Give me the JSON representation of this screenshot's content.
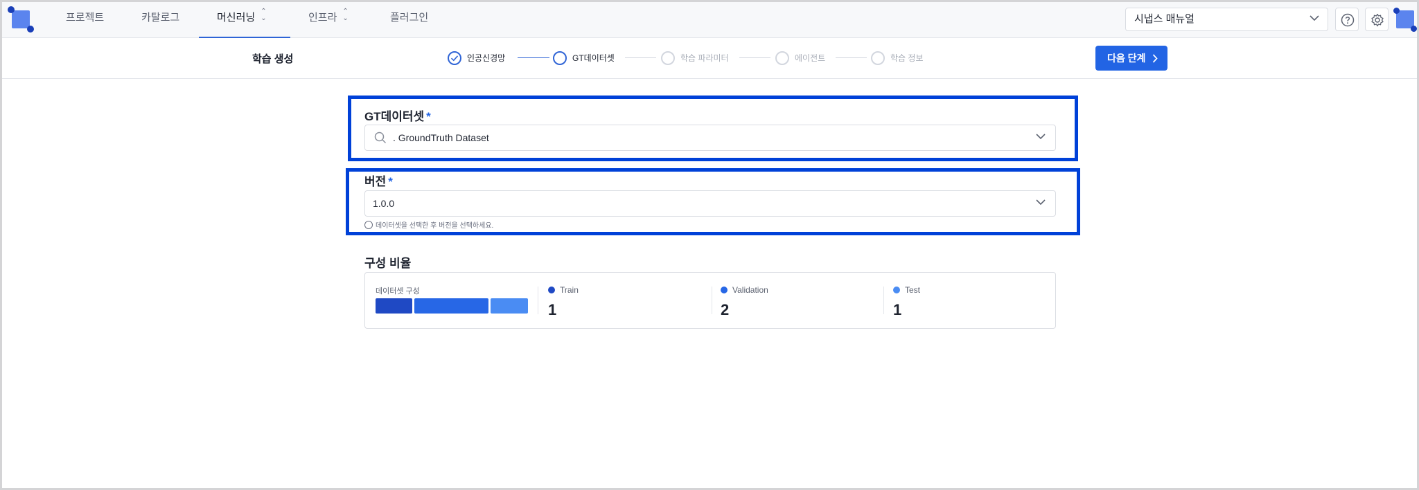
{
  "nav": {
    "items": [
      {
        "label": "프로젝트"
      },
      {
        "label": "카탈로그"
      },
      {
        "label": "머신러닝"
      },
      {
        "label": "인프라"
      },
      {
        "label": "플러그인"
      }
    ],
    "active": "머신러닝",
    "manual_select": "시냅스 매뉴얼"
  },
  "header": {
    "title": "학습 생성",
    "steps": [
      {
        "label": "인공신경망",
        "status": "done"
      },
      {
        "label": "GT데이터셋",
        "status": "current"
      },
      {
        "label": "학습 파라미터",
        "status": "pending"
      },
      {
        "label": "에이전트",
        "status": "pending"
      },
      {
        "label": "학습 정보",
        "status": "pending"
      }
    ],
    "next_label": "다음 단계"
  },
  "gt_dataset": {
    "label": "GT데이터셋",
    "required_mark": "*",
    "value": ". GroundTruth Dataset"
  },
  "version": {
    "label": "버전",
    "required_mark": "*",
    "value": "1.0.0",
    "hint": "데이터셋을 선택한 후 버전을 선택하세요."
  },
  "ratio": {
    "section_title": "구성 비율",
    "composition_label": "데이터셋 구성",
    "stats": [
      {
        "name": "Train",
        "value": "1",
        "color": "#1f49c4"
      },
      {
        "name": "Validation",
        "value": "2",
        "color": "#2767e6"
      },
      {
        "name": "Test",
        "value": "1",
        "color": "#4a8cf3"
      }
    ]
  },
  "colors": {
    "accent": "#2264e4",
    "highlight_border": "#0041d8"
  }
}
